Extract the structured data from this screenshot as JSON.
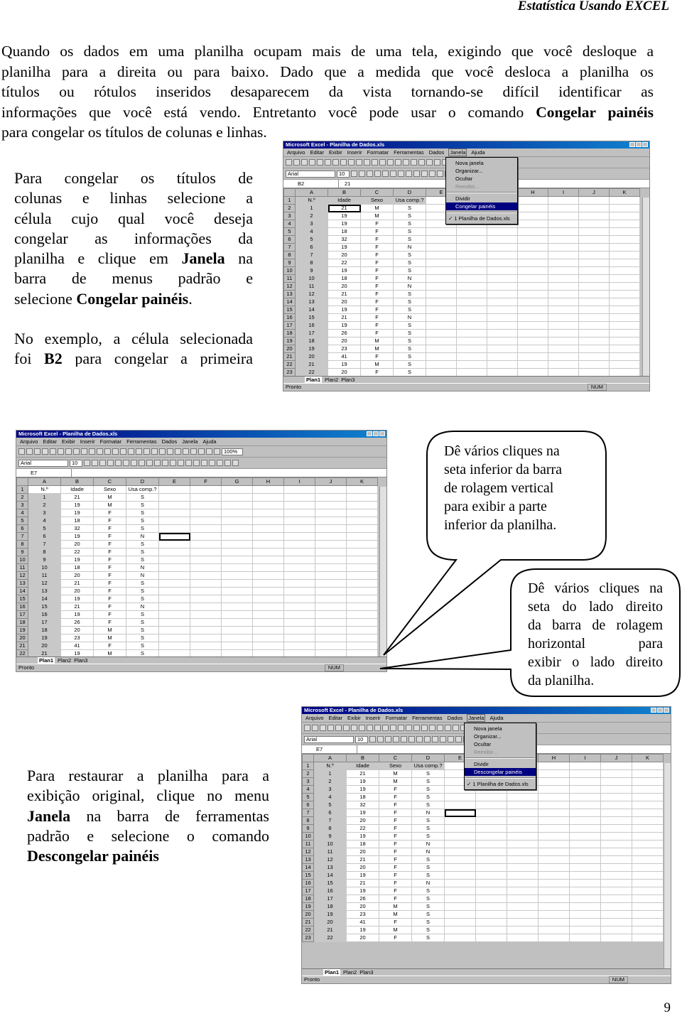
{
  "header": "Estatística Usando EXCEL",
  "intro": {
    "lines": [
      "Quando os dados em uma planilha ocupam mais de uma tela, exigindo que você desloque a",
      "planilha para a direita ou para baixo. Dado que a medida que você desloca a planilha os",
      "títulos ou rótulos inseridos desaparecem da vista tornando-se difícil identificar as"
    ],
    "line4_a": "informações que você está vendo. Entretanto você pode usar o comando ",
    "line4_b": "Congelar painéis",
    "line5": "para congelar os títulos de colunas e linhas."
  },
  "freeze_text": {
    "l1": "Para congelar os títulos de",
    "l2": "colunas e linhas selecione a",
    "l3": "célula cujo qual você deseja",
    "l4": "congelar as informações da",
    "l5a": "planilha e clique em ",
    "l5b": "Janela",
    "l5c": " na",
    "l6": "barra de menus padrão e",
    "l7a": "selecione ",
    "l7b": "Congelar painéis",
    "l7c": ".",
    "l8": "No exemplo, a célula selecionada",
    "l9a": "foi ",
    "l9b": "B2",
    "l9c": " para congelar a primeira"
  },
  "restore_text": {
    "l1": "Para restaurar a planilha para a",
    "l2": "exibição original, clique no menu",
    "l3a": "Janela",
    "l3b": " na barra de ferramentas",
    "l4": "padrão e selecione o comando",
    "l5": "Descongelar painéis"
  },
  "callout_vertical": [
    "Dê vários cliques na",
    "seta inferior da barra",
    "de rolagem vertical",
    "para exibir a parte",
    "inferior da planilha."
  ],
  "callout_horizontal": [
    "Dê vários cliques na",
    "seta do lado direito",
    "da barra de rolagem",
    "horizontal para",
    "exibir o lado direito",
    "da planilha."
  ],
  "page_number": "9",
  "excel": {
    "title": "Microsoft Excel - Planilha de Dados.xls",
    "menus": [
      "Arquivo",
      "Editar",
      "Exibir",
      "Inserir",
      "Formatar",
      "Ferramentas",
      "Dados",
      "Janela",
      "Ajuda"
    ],
    "font": "Arial",
    "size": "10",
    "zoom": "100%",
    "columns": [
      "A",
      "B",
      "C",
      "D",
      "E",
      "F",
      "G",
      "H",
      "I",
      "J",
      "K"
    ],
    "headers": [
      "N.º",
      "Idade",
      "Sexo",
      "Usa comp.?"
    ],
    "idade": [
      21,
      19,
      19,
      18,
      32,
      19,
      20,
      22,
      19,
      18,
      20,
      21,
      20,
      19,
      21,
      19,
      26,
      20,
      23,
      41,
      19,
      20
    ],
    "sexo": [
      "M",
      "M",
      "F",
      "F",
      "F",
      "F",
      "F",
      "F",
      "F",
      "F",
      "F",
      "F",
      "F",
      "F",
      "F",
      "F",
      "F",
      "M",
      "M",
      "F",
      "M",
      "F"
    ],
    "usa": [
      "S",
      "S",
      "S",
      "S",
      "S",
      "N",
      "S",
      "S",
      "S",
      "N",
      "N",
      "S",
      "S",
      "S",
      "N",
      "S",
      "S",
      "S",
      "S",
      "S",
      "S",
      "S"
    ],
    "sheets": [
      "Plan1",
      "Plan2",
      "Plan3"
    ],
    "status": "Pronto",
    "num": "NUM",
    "windows": [
      {
        "cell": "B2",
        "formula": "21",
        "menu": [
          "Nova janela",
          "Organizar...",
          "Ocultar",
          "Reexibir...",
          "Dividir",
          "Congelar painéis",
          "1 Planilha de Dados.xls"
        ]
      },
      {
        "cell": "E7",
        "formula": ""
      },
      {
        "cell": "E7",
        "formula": "",
        "menu": [
          "Nova janela",
          "Organizar...",
          "Ocultar",
          "Reexibir...",
          "Dividir",
          "Descongelar painéis",
          "1 Planilha de Dados.xls"
        ]
      }
    ]
  }
}
